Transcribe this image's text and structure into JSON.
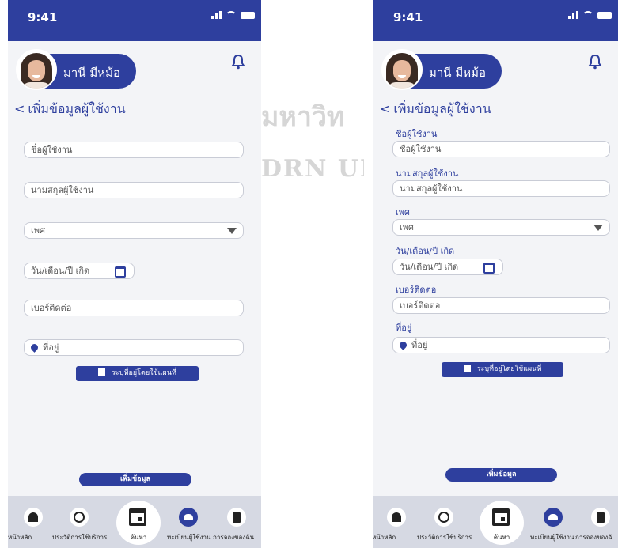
{
  "watermark": {
    "line1": "มหาวิท",
    "line2": "DRN UNI"
  },
  "status": {
    "time": "9:41"
  },
  "user": {
    "name": "มานี มีหม้อ"
  },
  "page": {
    "title": "เพิ่มข้อมูลผู้ใช้งาน"
  },
  "form": {
    "first_name": {
      "label": "ชื่อผู้ใช้งาน",
      "placeholder": "ชื่อผู้ใช้งาน"
    },
    "last_name": {
      "label": "นามสกุลผู้ใช้งาน",
      "placeholder": "นามสกุลผู้ใช้งาน"
    },
    "gender": {
      "label": "เพศ",
      "value": "เพศ"
    },
    "birthdate": {
      "label": "วัน/เดือน/ปี เกิด",
      "placeholder": "วัน/เดือน/ปี เกิด"
    },
    "phone": {
      "label": "เบอร์ติดต่อ",
      "placeholder": "เบอร์ติดต่อ"
    },
    "address": {
      "label": "ที่อยู่",
      "placeholder": "ที่อยู่"
    },
    "map_button": "ระบุที่อยู่โดยใช้แผนที่",
    "submit_button": "เพิ่มข้อมูล"
  },
  "nav": {
    "home": "หน้าหลัก",
    "history": "ประวัติการใช้บริการ",
    "search": "ค้นหา",
    "register": "ทะเบียนผู้ใช้งาน",
    "booking_left": "การจองของฉัน",
    "booking_right": "การจองของฉั"
  },
  "colors": {
    "primary": "#2e3f9e",
    "background": "#f3f4f7",
    "nav_bg": "#d6d9e3"
  }
}
